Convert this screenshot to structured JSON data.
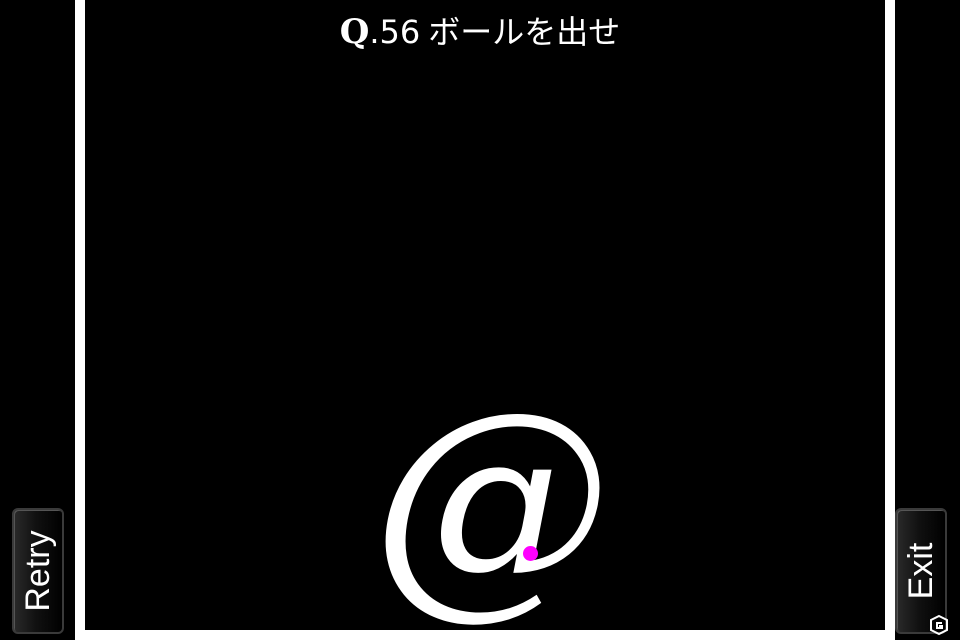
{
  "question": {
    "prefix": "Q",
    "number": ".56",
    "text": "ボールを出せ"
  },
  "buttons": {
    "retry_label": "Retry",
    "exit_label": "Exit"
  },
  "puzzle": {
    "glyph": "@"
  },
  "colors": {
    "background": "#000000",
    "frame": "#ffffff",
    "ball": "#ff00ff",
    "text": "#ffffff"
  },
  "icons": {
    "watermark": "site-logo-icon"
  }
}
